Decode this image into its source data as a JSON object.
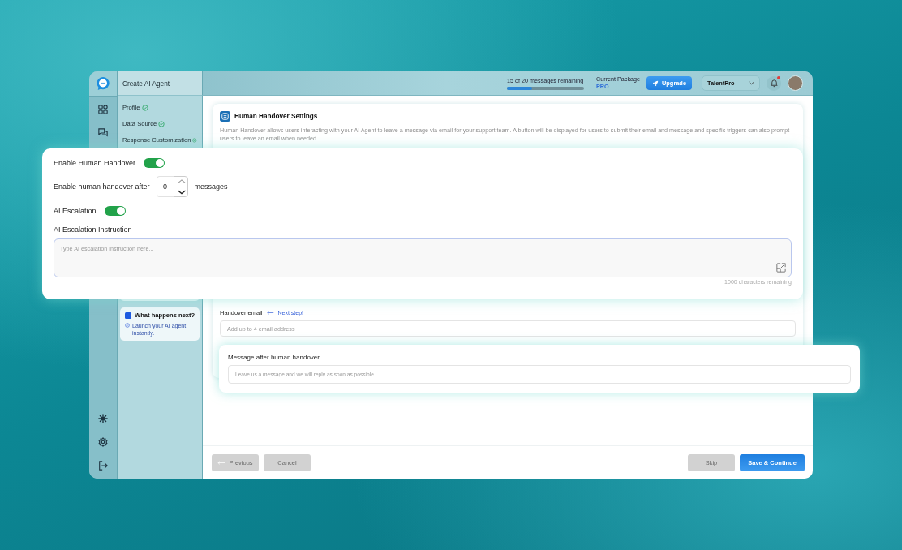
{
  "steps_panel": {
    "title": "Create AI Agent",
    "steps": [
      {
        "label": "Profile",
        "completed": true
      },
      {
        "label": "Data Source",
        "completed": true
      },
      {
        "label": "Response Customization",
        "completed": true
      }
    ],
    "next_card": {
      "title": "What happens next?",
      "text": "Launch your AI agent instantly."
    }
  },
  "top_bar": {
    "usage": {
      "text": "15 of 20 messages remaining",
      "level": 0.33
    },
    "package": {
      "label": "Current Package",
      "value": "PRO"
    },
    "upgrade_button": "Upgrade",
    "workspace": "TalentPro",
    "notifications": {
      "unread": true
    }
  },
  "settings_card": {
    "title": "Human Handover Settings",
    "description": "Human Handover allows users interacting with your AI Agent to leave a message via email for your support team. A button will be displayed for users to submit their email and message and specific triggers can also prompt users to leave an email when needed.",
    "handover_email": {
      "label": "Handover email",
      "hint": "Next step!",
      "placeholder": "Add up to 4 email address"
    }
  },
  "handover_panel": {
    "enable_toggle": {
      "label": "Enable Human Handover",
      "on": true
    },
    "after_messages": {
      "label": "Enable human handover after",
      "value": "0",
      "unit": "messages"
    },
    "escalation_toggle": {
      "label": "AI Escalation",
      "on": true
    },
    "instruction": {
      "label": "AI Escalation Instruction",
      "placeholder": "Type AI escalation instruction here...",
      "counter": "1000 characters remaining"
    }
  },
  "message_panel": {
    "label": "Message after human handover",
    "placeholder": "Leave us a message and we will reply as soon as possible"
  },
  "footer": {
    "left_buttons": [
      {
        "label": "Previous",
        "kind": "back",
        "disabled": true
      },
      {
        "label": "Cancel",
        "kind": "plain",
        "disabled": true
      }
    ],
    "right_buttons": [
      {
        "label": "Skip",
        "kind": "plain",
        "disabled": true
      },
      {
        "label": "Save & Continue",
        "kind": "primary",
        "disabled": false
      }
    ]
  }
}
